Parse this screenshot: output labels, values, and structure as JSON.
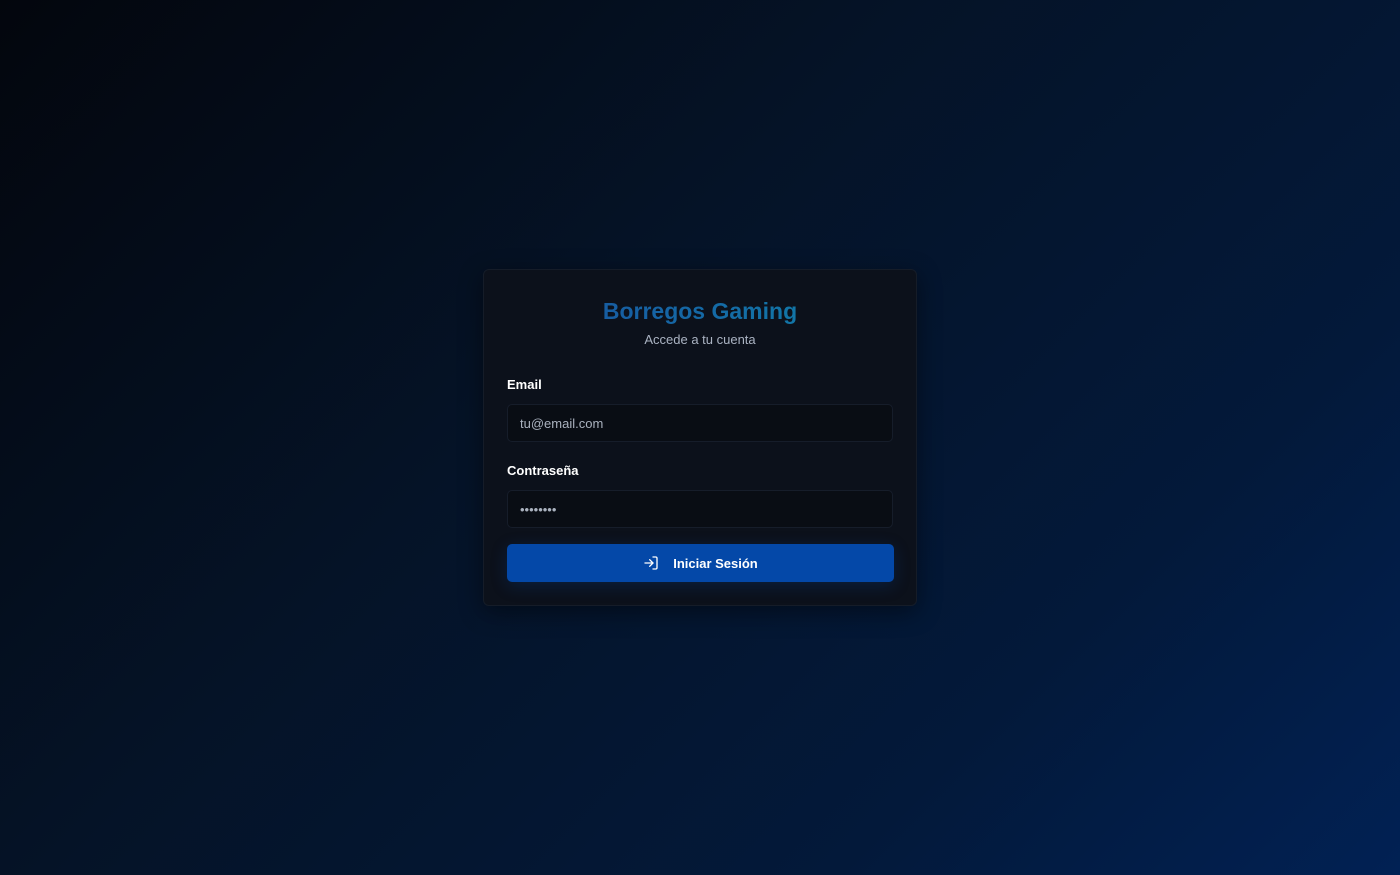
{
  "app": {
    "title": "Borregos Gaming",
    "subtitle": "Accede a tu cuenta"
  },
  "form": {
    "email": {
      "label": "Email",
      "placeholder": "tu@email.com",
      "value": ""
    },
    "password": {
      "label": "Contraseña",
      "placeholder": "••••••••",
      "value": ""
    },
    "submit": {
      "label": "Iniciar Sesión",
      "icon": "login-icon"
    }
  },
  "colors": {
    "accent": "#0448a8",
    "title_gradient_start": "#1a4f9c",
    "title_gradient_end": "#0f86a8",
    "card_background": "#0c111b"
  }
}
